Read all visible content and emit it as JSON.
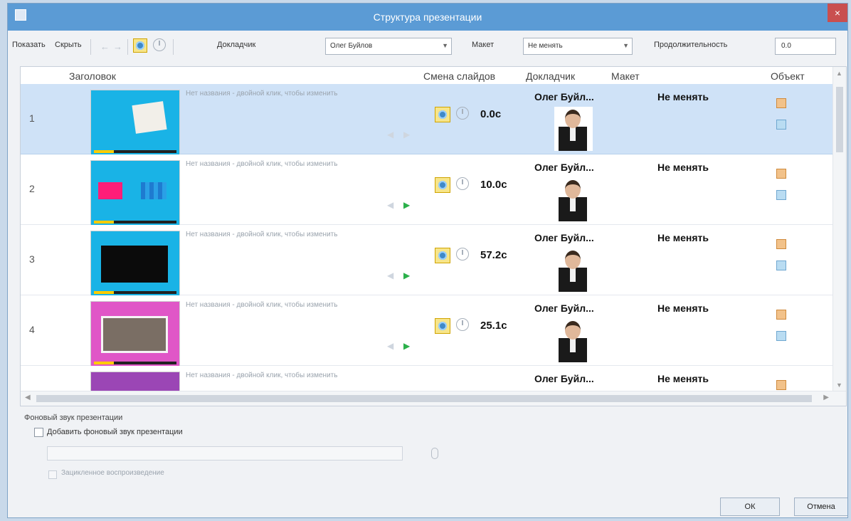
{
  "window": {
    "title": "Структура презентации",
    "close": "×"
  },
  "toolbar": {
    "show": "Показать",
    "hide": "Скрыть",
    "narrator_label": "Докладчик",
    "narrator_value": "Олег Буйлов",
    "layout_label": "Макет",
    "layout_value": "Не менять",
    "duration_label": "Продолжительность",
    "duration_value": "0.0"
  },
  "table": {
    "headers": {
      "title": "Заголовок",
      "transition": "Смена слайдов",
      "narrator": "Докладчик",
      "layout": "Макет",
      "object": "Объект"
    },
    "no_title_text": "Нет названия - двойной клик, чтобы изменить",
    "rows": [
      {
        "index": "1",
        "duration": "0.0с",
        "narrator": "Олег Буйл...",
        "layout": "Не менять"
      },
      {
        "index": "2",
        "duration": "10.0с",
        "narrator": "Олег Буйл...",
        "layout": "Не менять"
      },
      {
        "index": "3",
        "duration": "57.2с",
        "narrator": "Олег Буйл...",
        "layout": "Не менять"
      },
      {
        "index": "4",
        "duration": "25.1с",
        "narrator": "Олег Буйл...",
        "layout": "Не менять"
      },
      {
        "index": "",
        "duration": "",
        "narrator": "Олег Буйл...",
        "layout": "Не менять"
      }
    ]
  },
  "bottom": {
    "bgm_title": "Фоновый звук презентации",
    "add_bgm": "Добавить фоновый звук презентации",
    "loop": "Зацикленное воспроизведение"
  },
  "buttons": {
    "ok": "ОК",
    "cancel": "Отмена"
  },
  "colors": {
    "titlebar": "#5b9bd5",
    "selected_row": "#cfe2f7",
    "slide_cyan": "#19b3e6",
    "slide_pink": "#e056c7"
  }
}
